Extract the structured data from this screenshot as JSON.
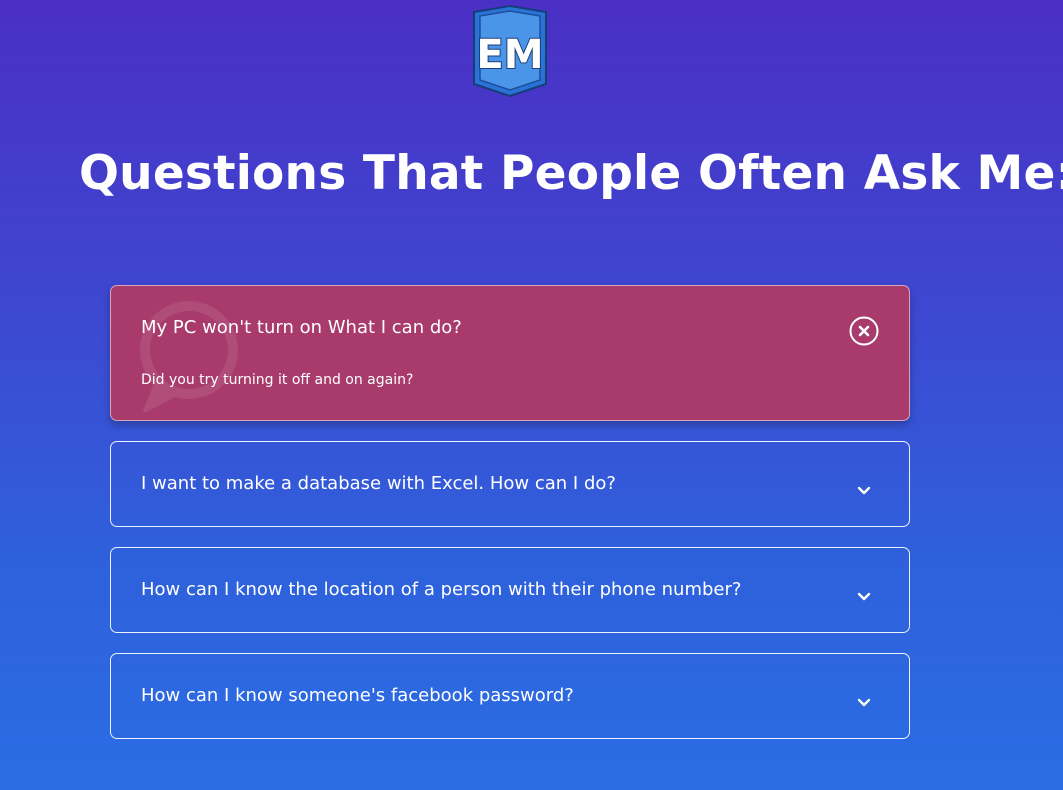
{
  "logo": {
    "icon": "em-shield-logo",
    "text": "EM"
  },
  "page_title": "Questions That People Often Ask Me:",
  "faq": [
    {
      "question": "My PC won't turn on What I can do?",
      "answer": "Did you try turning it off and on again?",
      "expanded": true,
      "toggle_icon": "close-circle-icon"
    },
    {
      "question": "I want to make a database with Excel. How can I do?",
      "expanded": false,
      "toggle_icon": "chevron-down-icon"
    },
    {
      "question": "How can I know the location of a person with their phone number?",
      "expanded": false,
      "toggle_icon": "chevron-down-icon"
    },
    {
      "question": "How can I know someone's facebook password?",
      "expanded": false,
      "toggle_icon": "chevron-down-icon"
    }
  ],
  "colors": {
    "background_top": "#4a2fc4",
    "background_bottom": "#2a6de3",
    "expanded_item": "#a83b6b",
    "text": "#ffffff"
  }
}
